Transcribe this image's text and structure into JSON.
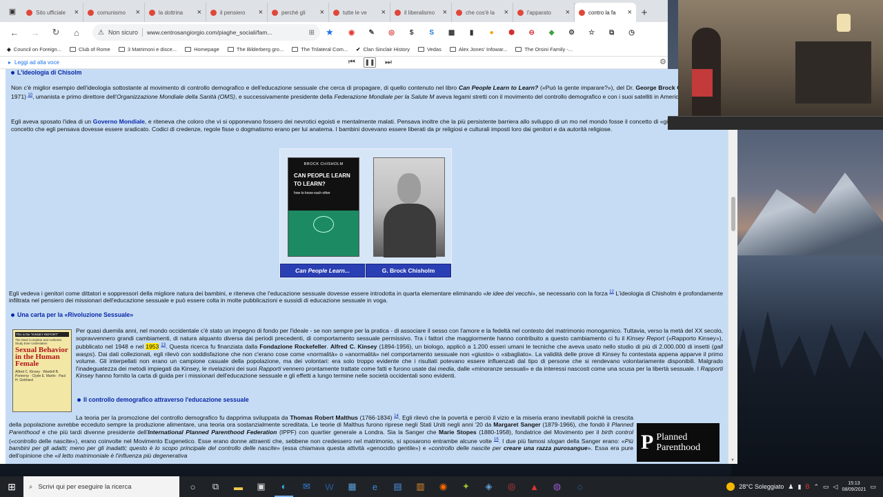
{
  "browser": {
    "tabs": [
      {
        "label": "Sito ufficiale",
        "active": false
      },
      {
        "label": "comunismo",
        "active": false
      },
      {
        "label": "la dottrina",
        "active": false
      },
      {
        "label": "il pensiero",
        "active": false
      },
      {
        "label": "perché gli",
        "active": false
      },
      {
        "label": "tutte le ve",
        "active": false
      },
      {
        "label": "il liberalismo",
        "active": false
      },
      {
        "label": "che cos'è la",
        "active": false
      },
      {
        "label": "l'apparato",
        "active": false
      },
      {
        "label": "contro la fa",
        "active": true
      }
    ],
    "new_tab": "+",
    "security_label": "Non sicuro",
    "url": "www.centrosangiorgio.com/piaghe_sociali/fam...",
    "bookmarks": [
      "Council on Foreign...",
      "Club of Rome",
      "3 Matrimoni e disce...",
      "Homepage",
      "The Bilderberg gro...",
      "The Trilateral Com...",
      "Clan Sinclair History",
      "Vedas",
      "Alex Jones' Infowar...",
      "The Orsini Family -..."
    ]
  },
  "reader": {
    "label": "Leggi ad alta voce"
  },
  "article": {
    "h_chisolm": "L'ideologia di Chisolm",
    "p1_a": "Non c'è miglior esempio dell'ideologia sottostante al movimento di controllo demografico e dell'educazione sessuale che cerca di propagare, di quello contenuto nel libro",
    "p1_book": "Can People Learn to Learn?",
    "p1_b": "(«Può la gente imparare?»), del Dr.",
    "p1_name": "George Brock Chisholm",
    "p1_c": "(1896-1971)",
    "p1_ref": "10",
    "p1_d": ", umanista e primo direttore dell'",
    "p1_oms": "Organizzazione Mondiale della Sanità (OMS)",
    "p1_e": ", e successivamente presidente della",
    "p1_fed": "Federazione Mondiale per la Salute M",
    "p1_f": "aveva legami stretti con il movimento del controllo demografico e con i suoi satelliti in America",
    "p1_ref2": "11",
    "p2_a": "Egli aveva sposato l'idea di un",
    "p2_link": "Governo Mondiale",
    "p2_b": ", e riteneva che coloro che vi si opponevano fossero dei nevrotici egoisti e mentalmente malati. Pensava inoltre che la più persistente barriera allo sviluppo di un mo nel mondo fosse il concetto di «giusto e sbagliato», un concetto che egli pensava dovesse essere sradicato. Codici di credenze, regole fisse o dogmatismo erano per lui anatema. I bambini dovevano essere liberati da pr religiosi e culturali imposti loro dai genitori e da autorità religiose.",
    "fig_book": {
      "publisher": "BROCK CHISHOLM",
      "title": "CAN PEOPLE LEARN TO LEARN?",
      "subtitle": "how to know each other"
    },
    "fig_caption_1": "Can People Learn...",
    "fig_caption_2": "G. Brock Chisholm",
    "p3_a": "Egli vedeva i genitori come dittatori e soppressori della migliore natura dei bambini, e riteneva che l'educazione sessuale dovesse essere introdotta in quarta elementare eliminando «",
    "p3_i": "le idee dei vecchi",
    "p3_b": "», se necessario con la forza",
    "p3_ref": "12",
    "p3_c": "L'ideologia di Chisholm è profondamente infiltrata nel pensiero dei missionari dell'educazione sessuale e può essere colta in molte pubblicazioni e sussidi di educazione sessuale in voga.",
    "h_carta": "Una carta per la «Rivoluzione Sessuale»",
    "kinsey_book": {
      "banner": "This is the \"KINSEY REPORT\"",
      "line": "The Most Complete and Authentic Study Ever Undertaken",
      "title": "Sexual Behavior in the Human Female",
      "authors": "Alfred C. Kinsey · Wardell B. Pomeroy · Clyde E. Martin · Paul H. Gebhard"
    },
    "p4_a": "Per quasi duemila anni, nel mondo occidentale c'è stato un impegno di fondo per l'ideale - se non sempre per la pratica - di associare il sesso con l'amore e la fedeltà nel contesto del matrimonio monogamico. Tuttavia, verso la metà del XX secolo, sopravvennero grandi cambiamenti, di natura alquanto diversa dai periodi precedenti, di comportamento sessuale permissivo. Tra i fattori che maggiormente hanno contribuito a questo cambiamento ci fu il",
    "p4_kr": "Kinsey Report",
    "p4_b": "(«Rapporto Kinsey»), pubblicato nel 1948 e nel",
    "p4_year": "1953",
    "p4_ref": "13",
    "p4_c": ". Questa ricerca fu finanziata dalla",
    "p4_rock": "Fondazione Rockefeller",
    "p4_d": ".",
    "p4_kin": "Alfred C. Kinsey",
    "p4_e": "(1894-1956), un biologo, applicò a 1.200 esseri umani le tecniche che aveva usato nello studio di più di 2.000.000 di insetti (",
    "p4_gw": "gall wasps",
    "p4_f": "). Dai dati collezionati, egli rilevò con soddisfazione che non c'erano cose come «normalità» o «anormalità» nel comportamento sessuale non «giusto» o «sbagliato». La validità delle prove di Kinsey fu contestata appena apparve il primo volume. Gli interpellati non erano un campione casuale della popolazione, ma dei volontari: era solo troppo evidente che i risultati potevano essere influenzati dal tipo di persone che si rendevano volontariamente disponibili. Malgrado l'inadeguatezza dei metodi impiegati da Kinsey, le rivelazioni dei suoi",
    "p4_rap": "Rapporti",
    "p4_g": "vennero prontamente trattate come fatti e furono usate dai",
    "p4_media": "media",
    "p4_h": ", dalle «minoranze sessuali» e da interessi nascosti come una scusa per la libertà sessuale. I",
    "p4_rk": "Rapporti Kinsey",
    "p4_i": "hanno fornito la carta di guida per i missionari dell'educazione sessuale e gli effetti a lungo termine nelle società occidentali sono evidenti.",
    "h_controllo": "Il controllo demografico attraverso l'educazione sessuale",
    "p5_a": "La teoria per la promozione del controllo demografico fu dapprima sviluppata da",
    "p5_malthus": "Thomas Robert Malthus",
    "p5_b": "(1766-1834)",
    "p5_ref": "14",
    "p5_c": ". Egli rilevò che la povertà e perciò il vizio e la miseria erano inevitabili poiché la crescita della popolazione avrebbe ecceduto sempre la produzione alimentare, una teoria ora sostanzialmente screditata. Le teorie di Malthus furono riprese negli Stati Uniti negli anni '20 da",
    "p5_sanger": "Margaret Sanger",
    "p5_d": "(1879-1966), che fondò il",
    "p5_pp": "Planned Parenthood",
    "p5_e": "e che più tardi divenne presidente dell'",
    "p5_ippf": "International Planned Parenthood Federation",
    "p5_f": "(IPPF) con quartier generale a Londra. Sia la Sanger che",
    "p5_stopes": "Marie Stopes",
    "p5_g": "(1880-1958), fondatrice del Movimento per il",
    "p5_bc": "birth control",
    "p5_h": "(«controllo delle nascite»), erano coinvolte nel Movimento Eugenetico. Esse erano donne attraenti che, sebbene non credessero nel matrimonio, si sposarono entrambe alcune volte",
    "p5_ref2": "15",
    "p5_i": ". I due più famosi",
    "p5_slogan": "slogan",
    "p5_j": "della Sanger erano: «",
    "p5_q1": "Più bambini per gli adatti; meno per gli inadatti; questo è lo scopo principale del controllo delle nascite",
    "p5_k": "» (essa chiamava questa attività «genocidio gentile») e «",
    "p5_q2": "controllo delle nascite per",
    "p5_q2b": "creare una razza purosangue",
    "p5_l": "». Essa era pure dell'opinione che «",
    "p5_q3": "il letto matrimoniale è l'influenza più degenerativa",
    "planned_parenthood_logo": "Planned Parenthood"
  },
  "taskbar": {
    "search_placeholder": "Scrivi qui per eseguire la ricerca",
    "weather": "28°C Soleggiato",
    "time": "15:13",
    "date": "08/09/2021"
  }
}
